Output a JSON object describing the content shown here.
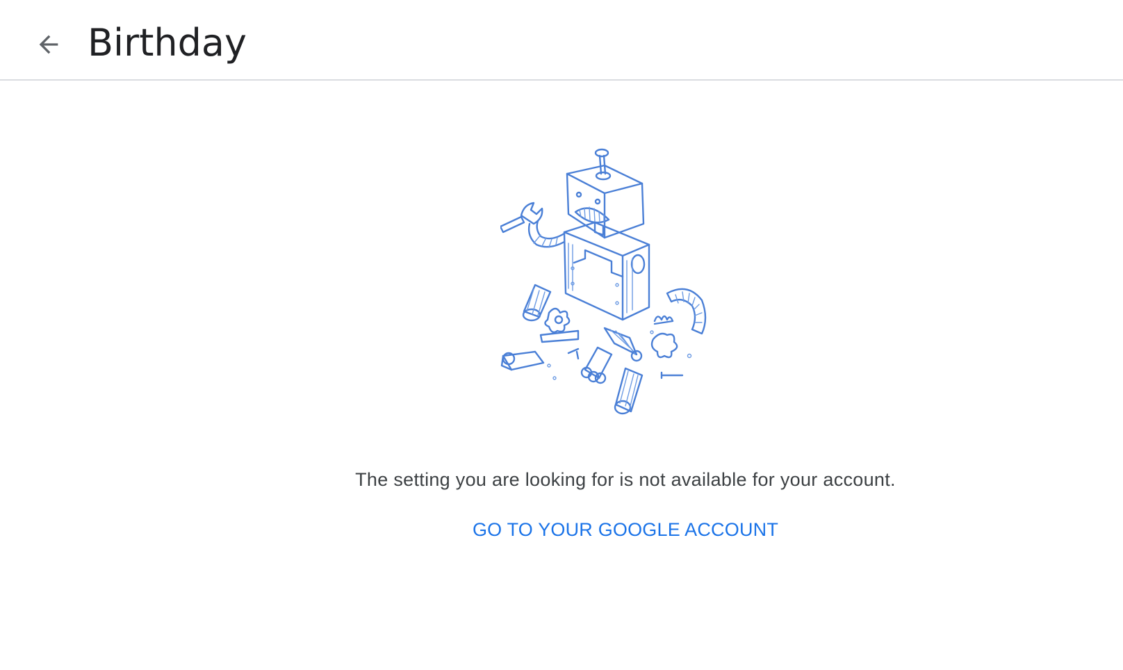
{
  "header": {
    "title": "Birthday",
    "back_icon": "arrow-back-icon"
  },
  "main": {
    "illustration": "broken-robot-illustration",
    "message": "The setting you are looking for is not available for your account.",
    "link_label": "GO TO YOUR GOOGLE ACCOUNT"
  },
  "colors": {
    "title": "#202124",
    "message": "#3c4043",
    "link": "#1a73e8",
    "illustration_stroke": "#4a7fd6",
    "divider": "#dadce0"
  }
}
